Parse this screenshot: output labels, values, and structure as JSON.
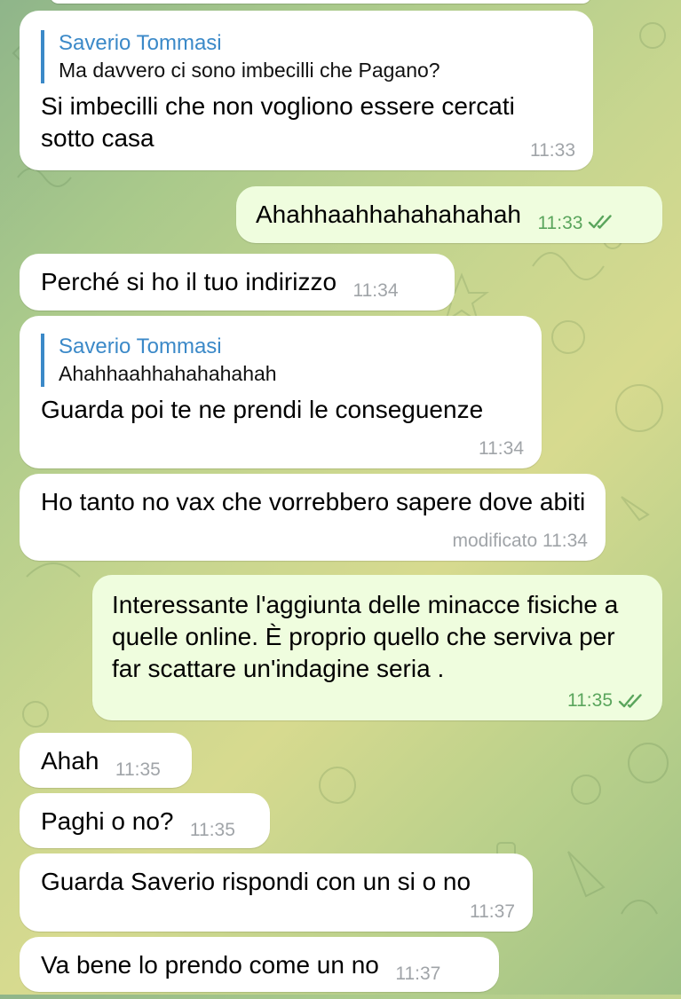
{
  "messages": [
    {
      "direction": "in",
      "reply": {
        "name": "Saverio Tommasi",
        "text": "Ma davvero ci sono imbecilli che Pagano?"
      },
      "text": "Si imbecilli che non vogliono essere cercati sotto casa",
      "time": "11:33"
    },
    {
      "direction": "out",
      "text": "Ahahhaahhahahahahah",
      "time": "11:33",
      "status_icon": "double-check-icon"
    },
    {
      "direction": "in",
      "text": "Perché si ho il tuo indirizzo",
      "time": "11:34"
    },
    {
      "direction": "in",
      "reply": {
        "name": "Saverio Tommasi",
        "text": "Ahahhaahhahahahahah"
      },
      "text": "Guarda poi te ne prendi le conseguenze",
      "time": "11:34"
    },
    {
      "direction": "in",
      "text": "Ho tanto no vax che vorrebbero sapere dove abiti",
      "time": "modificato 11:34"
    },
    {
      "direction": "out",
      "text": "Interessante l'aggiunta delle minacce fisiche a quelle online. È proprio quello che serviva per far scattare un'indagine seria .",
      "time": "11:35",
      "status_icon": "double-check-icon"
    },
    {
      "direction": "in",
      "text": "Ahah",
      "time": "11:35"
    },
    {
      "direction": "in",
      "text": "Paghi o no?",
      "time": "11:35"
    },
    {
      "direction": "in",
      "text": "Guarda Saverio rispondi con un si o no",
      "time": "11:37"
    },
    {
      "direction": "in",
      "text": "Va bene lo prendo come un no",
      "time": "11:37"
    }
  ],
  "colors": {
    "incoming_bubble": "#ffffff",
    "outgoing_bubble": "#effdde",
    "reply_accent": "#3b89c8",
    "outgoing_time": "#5aa55c",
    "incoming_time": "#a0a4a8"
  }
}
